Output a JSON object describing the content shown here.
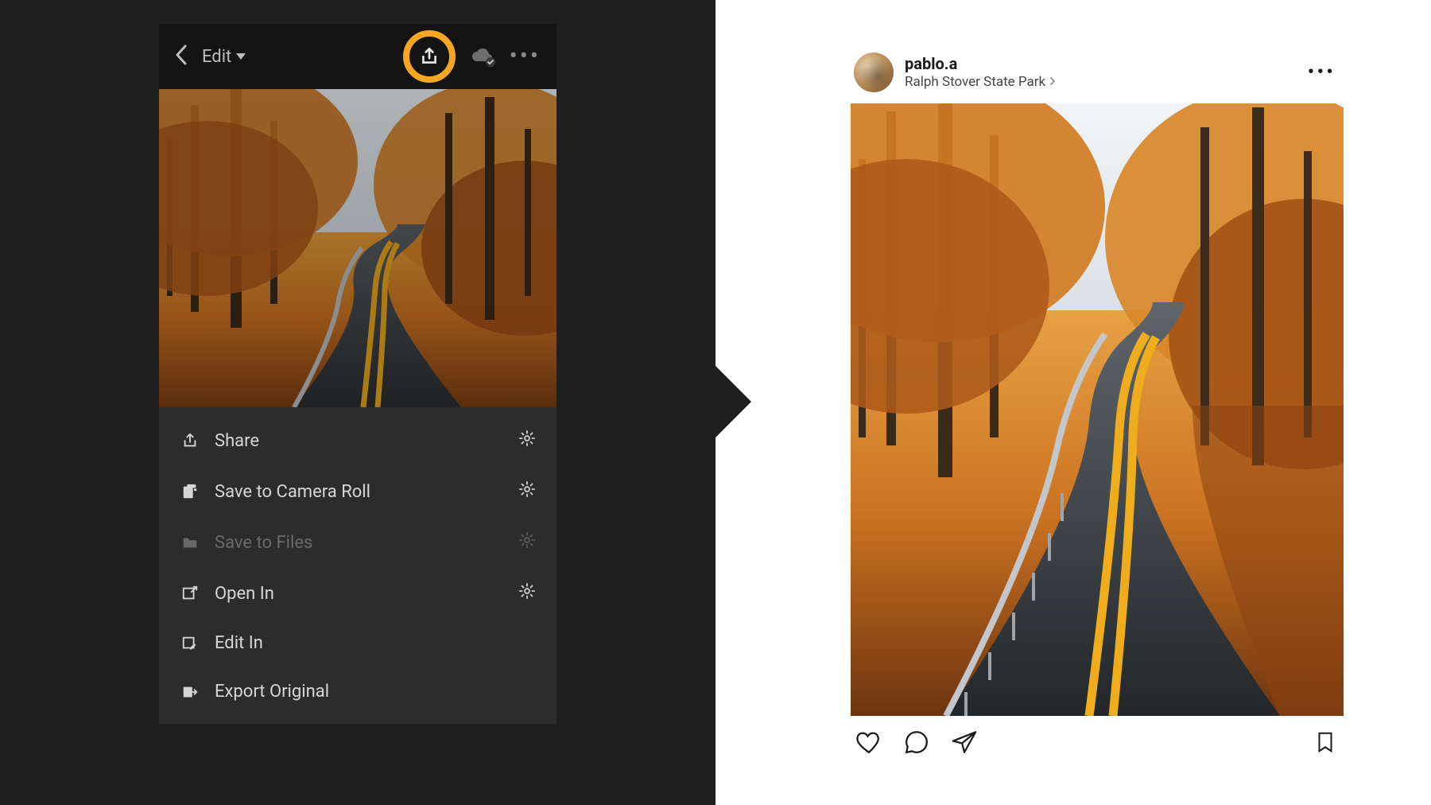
{
  "lightroom": {
    "edit_label": "Edit",
    "highlight_ring_color": "#f5a623",
    "menu": [
      {
        "icon": "share-icon",
        "label": "Share",
        "has_gear": true,
        "disabled": false
      },
      {
        "icon": "camera-roll-icon",
        "label": "Save to Camera Roll",
        "has_gear": true,
        "disabled": false
      },
      {
        "icon": "folder-icon",
        "label": "Save to Files",
        "has_gear": true,
        "disabled": true
      },
      {
        "icon": "open-in-icon",
        "label": "Open In",
        "has_gear": true,
        "disabled": false
      },
      {
        "icon": "edit-in-icon",
        "label": "Edit In",
        "has_gear": false,
        "disabled": false
      },
      {
        "icon": "export-original-icon",
        "label": "Export Original",
        "has_gear": false,
        "disabled": false
      }
    ]
  },
  "instagram": {
    "username": "pablo.a",
    "location": "Ralph Stover State Park"
  }
}
